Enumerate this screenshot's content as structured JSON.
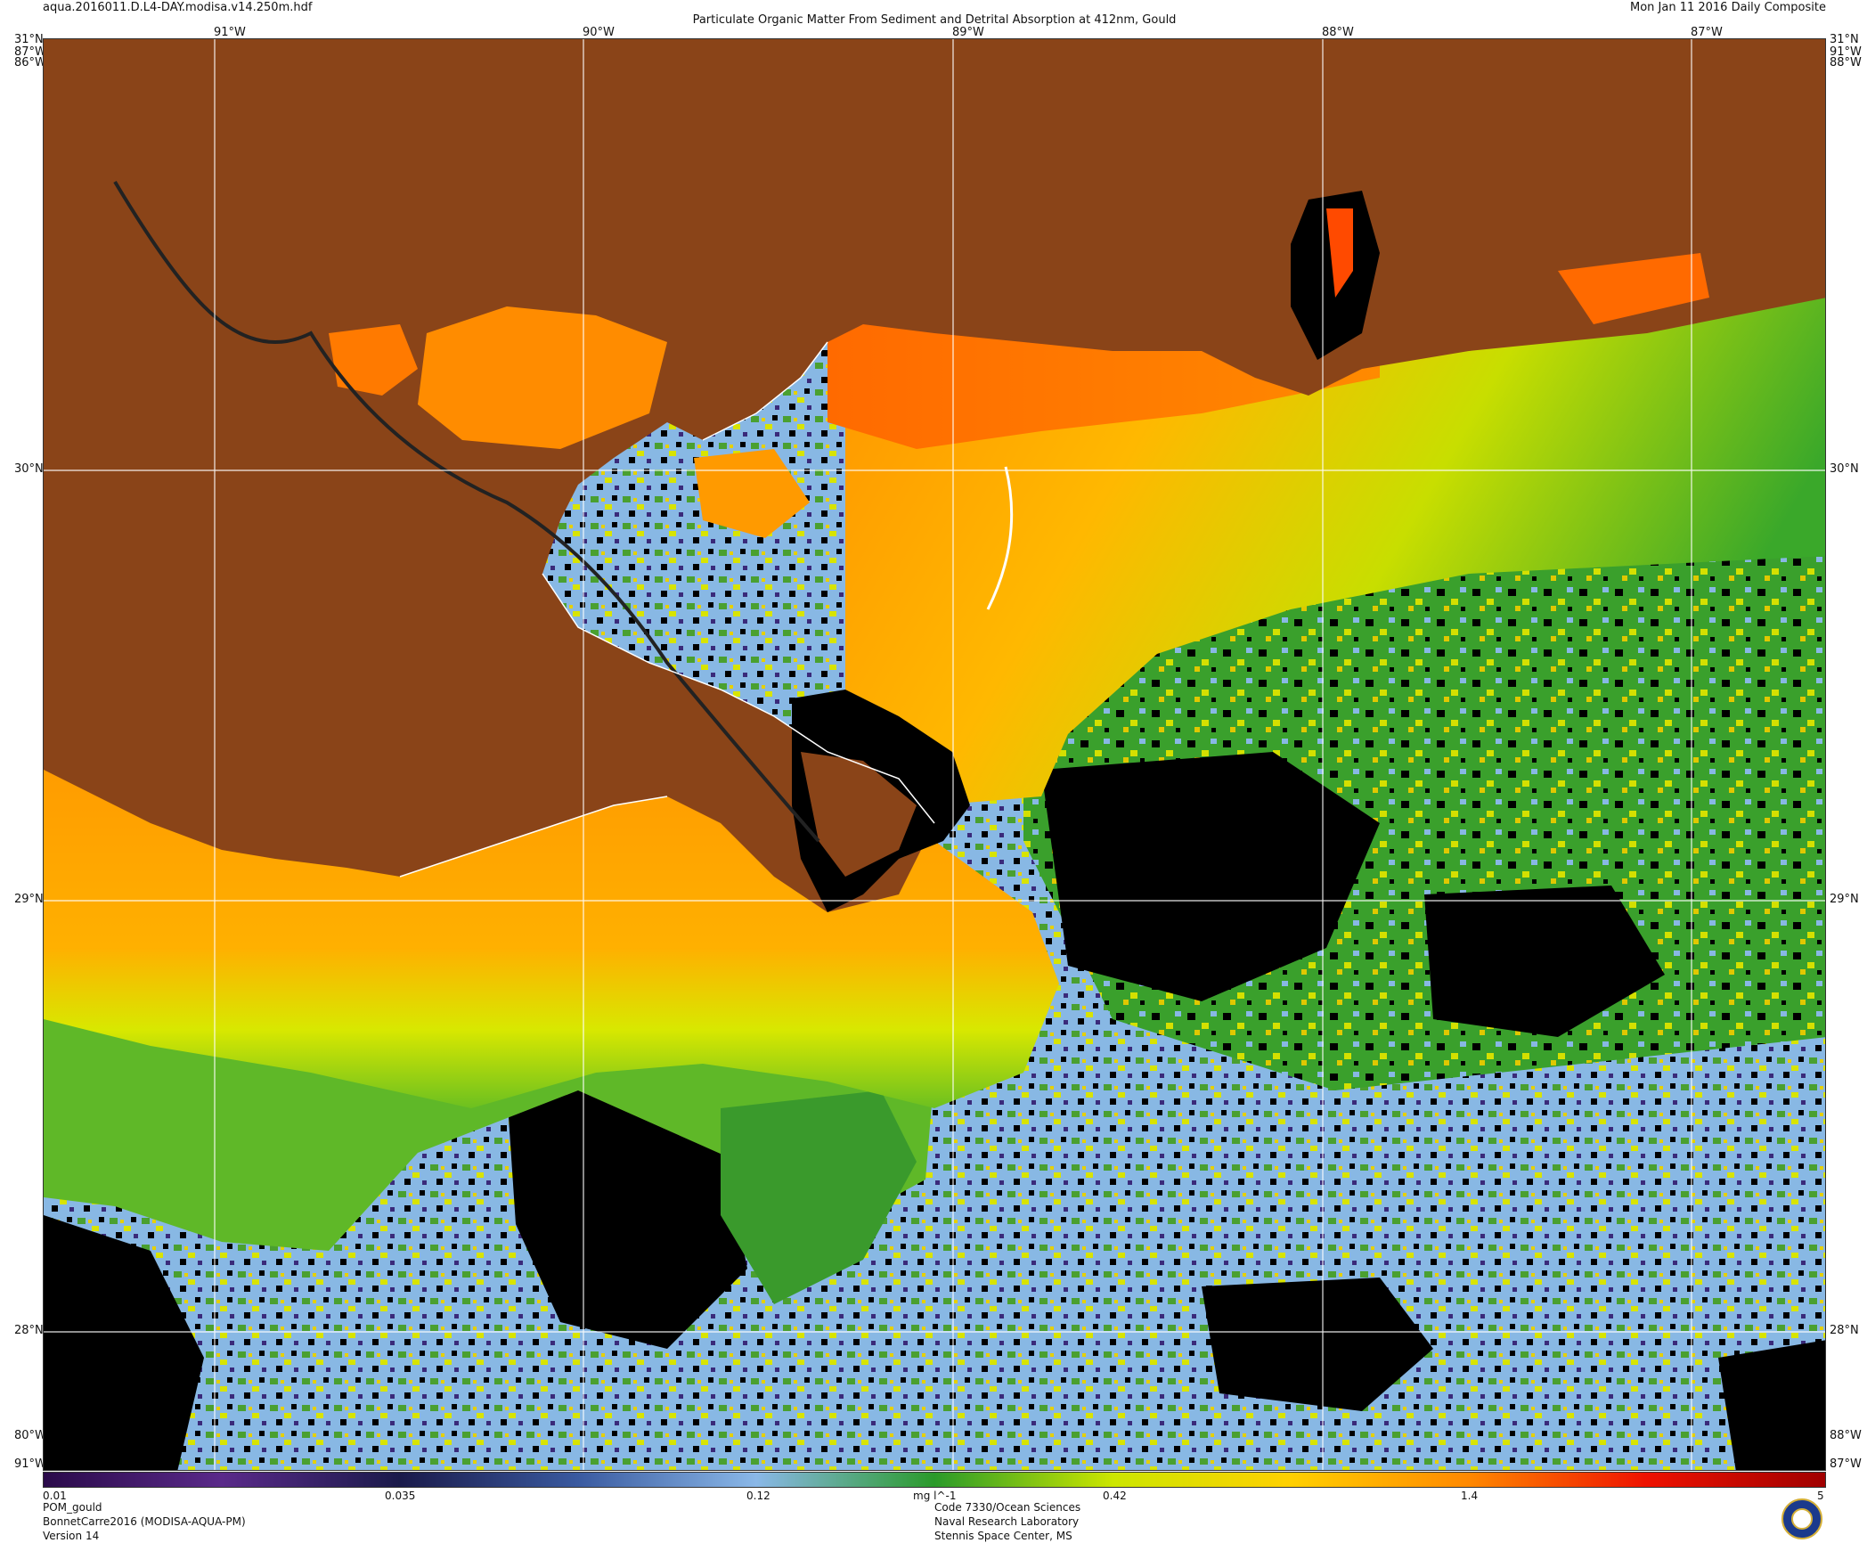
{
  "header": {
    "filename": "aqua.2016011.D.L4-DAY.modisa.v14.250m.hdf",
    "title": "Particulate Organic Matter From Sediment and Detrital Absorption at 412nm, Gould",
    "date": "Mon Jan 11 2016 Daily Composite"
  },
  "map": {
    "lon_range": [
      -91.5,
      -86.67
    ],
    "lat_range": [
      27.65,
      31.0
    ],
    "top_lon_labels": [
      "91°W",
      "90°W",
      "89°W",
      "88°W",
      "87°W"
    ],
    "lat_labels": [
      "31°N",
      "30°N",
      "29°N",
      "28°N"
    ],
    "corner_labels": {
      "top_left_lat": "31°N",
      "top_left_lon_a": "87°W",
      "top_left_lon_b": "86°W",
      "top_right_lat": "31°N",
      "top_right_lon_a": "91°W",
      "top_right_lon_b": "88°W",
      "bottom_left_a": "80°W",
      "bottom_left_b": "91°W",
      "bottom_right_a": "88°W",
      "bottom_right_b": "87°W"
    },
    "colors": {
      "land": "#8a4418",
      "no_data": "#000000",
      "graticule": "#ffffff",
      "coastline": "#ffffff"
    }
  },
  "colorbar": {
    "scale": "log",
    "range": [
      0.01,
      5
    ],
    "tick_labels": [
      "0.01",
      "0.035",
      "0.12",
      "0.42",
      "1.4",
      "5"
    ],
    "units": "mg l^-1",
    "stops": [
      "#2a0a4a",
      "#5a2a8a",
      "#1a1a4a",
      "#3a5aa0",
      "#8ab8e8",
      "#2a9a2a",
      "#cce600",
      "#ffd000",
      "#ff8800",
      "#ee1100",
      "#a00000"
    ]
  },
  "footer": {
    "left": [
      "POM_gould",
      "BonnetCarre2016 (MODISA-AQUA-PM)",
      "Version 14"
    ],
    "center": [
      "Code 7330/Ocean Sciences",
      "Naval Research Laboratory",
      "Stennis Space Center, MS"
    ]
  }
}
